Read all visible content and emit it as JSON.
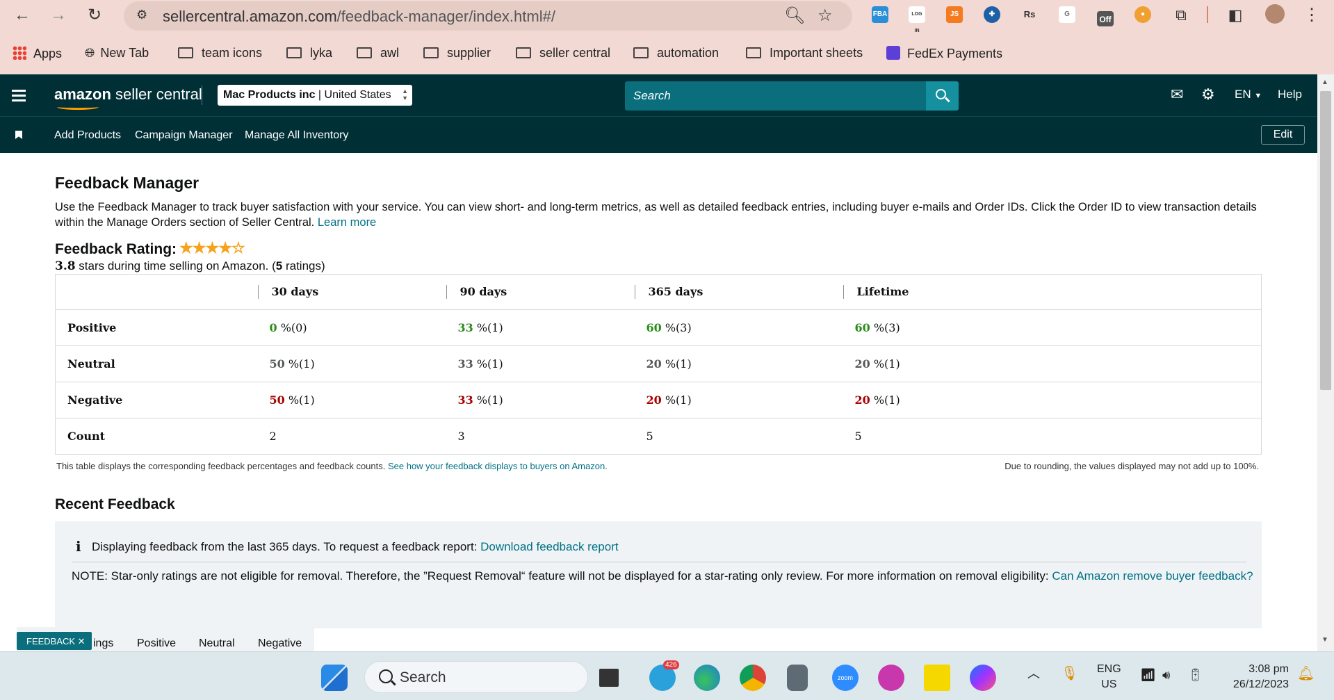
{
  "browser": {
    "url_host": "sellercentral.amazon.com",
    "url_path": "/feedback-manager/index.html#/",
    "extensions": [
      "FBA",
      "LOG IN",
      "JS",
      "Rs",
      "Off"
    ],
    "bookmarks": [
      "Apps",
      "New Tab",
      "team icons",
      "lyka",
      "awl",
      "supplier",
      "seller central",
      "automation",
      "Important sheets",
      "FedEx Payments"
    ]
  },
  "header": {
    "logo_bold": "amazon",
    "logo_rest": " seller central",
    "account_name": "Mac Products inc",
    "account_region": "United States",
    "search_placeholder": "Search",
    "language": "EN",
    "help": "Help"
  },
  "nav": {
    "links": [
      "Add Products",
      "Campaign Manager",
      "Manage All Inventory"
    ],
    "edit": "Edit"
  },
  "page": {
    "title": "Feedback Manager",
    "intro": "Use the Feedback Manager to track buyer satisfaction with your service. You can view short- and long-term metrics, as well as detailed feedback entries, including buyer e-mails and Order IDs. Click the Order ID to view transaction details within the Manage Orders section of Seller Central.",
    "learn_more": "Learn more",
    "rating_label": "Feedback Rating:",
    "rating_stars": 3.8,
    "stars_value": "3.8",
    "stars_text": " stars during time selling on Amazon. (",
    "ratings_count": "5",
    "ratings_suffix": " ratings)",
    "table": {
      "columns": [
        "30 days",
        "90 days",
        "365 days",
        "Lifetime"
      ],
      "rows": [
        {
          "label": "Positive",
          "cells": [
            [
              "0",
              " %(0)"
            ],
            [
              "33",
              " %(1)"
            ],
            [
              "60",
              " %(3)"
            ],
            [
              "60",
              " %(3)"
            ]
          ]
        },
        {
          "label": "Neutral",
          "cells": [
            [
              "50",
              " %(1)"
            ],
            [
              "33",
              " %(1)"
            ],
            [
              "20",
              " %(1)"
            ],
            [
              "20",
              " %(1)"
            ]
          ]
        },
        {
          "label": "Negative",
          "cells": [
            [
              "50",
              " %(1)"
            ],
            [
              "33",
              " %(1)"
            ],
            [
              "20",
              " %(1)"
            ],
            [
              "20",
              " %(1)"
            ]
          ]
        },
        {
          "label": "Count",
          "cells": [
            [
              "2",
              ""
            ],
            [
              "3",
              ""
            ],
            [
              "5",
              ""
            ],
            [
              "5",
              ""
            ]
          ]
        }
      ]
    },
    "footnote_left": "This table displays the corresponding feedback percentages and feedback counts.",
    "footnote_link": "See how your feedback displays to buyers on Amazon.",
    "footnote_right": "Due to rounding, the values displayed may not add up to 100%.",
    "recent_title": "Recent Feedback",
    "info_line": "Displaying feedback from the last 365 days. To request a feedback report:",
    "info_link": "Download feedback report",
    "note": "NOTE: Star-only ratings are not eligible for removal. Therefore, the ”Request Removal“ feature will not be displayed for a star-rating only review. For more information on removal eligibility:",
    "note_link": "Can Amazon remove buyer feedback?",
    "tabs": [
      "ings",
      "Positive",
      "Neutral",
      "Negative"
    ],
    "feedback_badge": "FEEDBACK ✕"
  },
  "taskbar": {
    "search": "Search",
    "telegram_badge": "426",
    "zoom_label": "zoom",
    "lang_top": "ENG",
    "lang_bottom": "US",
    "time": "3:08 pm",
    "date": "26/12/2023"
  },
  "colors": {
    "header_bg": "#002f36",
    "link": "#007185",
    "positive": "#2a8c1a",
    "negative": "#aa0000",
    "chrome_bg": "#f2d9d3"
  }
}
